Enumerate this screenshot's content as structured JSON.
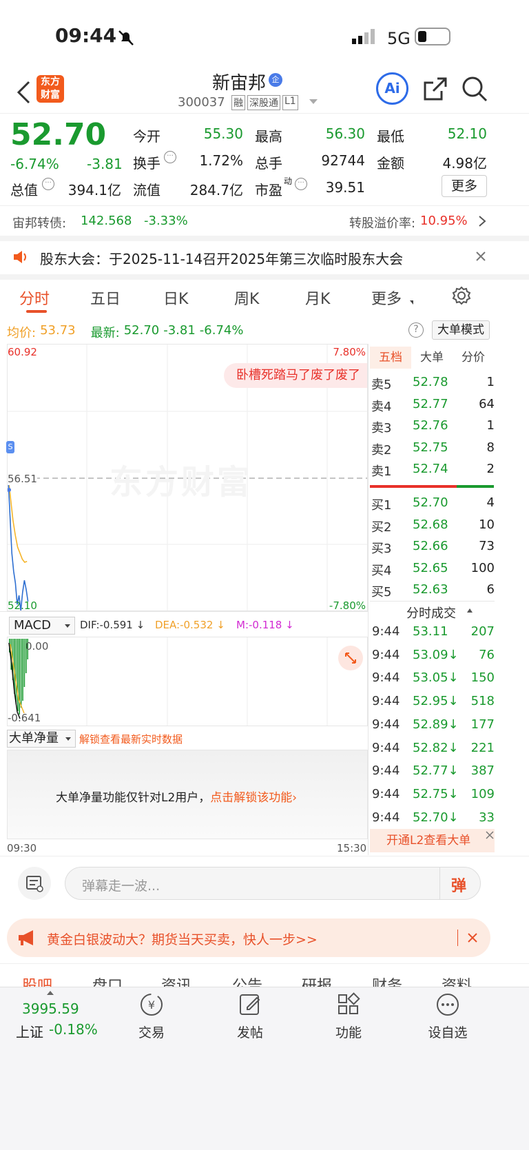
{
  "status": {
    "time": "09:44",
    "network": "5G"
  },
  "header": {
    "stock_name": "新宙邦",
    "badge": "企",
    "code": "300037",
    "tags": [
      "融",
      "深股通",
      "L1"
    ],
    "ai_label": "Ai"
  },
  "logo": {
    "line1": "东方",
    "line2": "财富"
  },
  "quote": {
    "price": "52.70",
    "pct": "-6.74%",
    "chg": "-3.81",
    "r1": [
      [
        "今开",
        "55.30",
        "green"
      ],
      [
        "最高",
        "56.30",
        "green"
      ],
      [
        "最低",
        "52.10",
        "green"
      ]
    ],
    "r2": [
      [
        "换手",
        "1.72%",
        ""
      ],
      [
        "总手",
        "92744",
        ""
      ],
      [
        "金额",
        "4.98亿",
        ""
      ]
    ],
    "r3": [
      [
        "总值",
        "394.1亿"
      ],
      [
        "流值",
        "284.7亿"
      ],
      [
        "市盈",
        "39.51"
      ]
    ],
    "pe_sup": "动",
    "more": "更多"
  },
  "bond": {
    "name": "宙邦转债:",
    "price": "142.568",
    "pct": "-3.33%",
    "premium_label": "转股溢价率:",
    "premium": "10.95%"
  },
  "notice": {
    "text": "股东大会：于2025-11-14召开2025年第三次临时股东大会"
  },
  "tabs": [
    "分时",
    "五日",
    "日K",
    "周K",
    "月K",
    "更多"
  ],
  "info_line": {
    "avg_label": "均价:",
    "avg": "53.73",
    "latest_label": "最新:",
    "latest": "52.70",
    "chg": "-3.81",
    "pct": "-6.74%",
    "mode": "大单模式"
  },
  "chart_axes": {
    "top": "60.92",
    "top_pct": "7.80%",
    "mid": "56.51",
    "bottom": "52.10",
    "bottom_pct": "-7.80%",
    "start_time": "09:30",
    "end_time": "15:30",
    "watermark": "东方财富",
    "danmu": "卧槽死踏马了废了废了"
  },
  "chart_data": {
    "type": "line",
    "series": [
      {
        "name": "价格",
        "values": [
          56.4,
          55.2,
          54.0,
          53.4,
          53.0,
          52.3,
          52.6,
          52.1,
          52.7,
          53.1,
          52.8,
          52.4
        ]
      },
      {
        "name": "均价",
        "values": [
          56.5,
          55.8,
          55.1,
          54.6,
          54.2,
          54.0,
          53.8,
          53.7,
          53.73
        ]
      }
    ],
    "ylim": [
      52.1,
      60.92
    ]
  },
  "macd": {
    "label": "MACD",
    "dif": "DIF:-0.591 ↓",
    "dea": "DEA:-0.532 ↓",
    "m": "M:-0.118 ↓",
    "top": "0.00",
    "bottom": "-0.641"
  },
  "bigorder": {
    "label": "大单净量",
    "unlock": "解锁查看最新实时数据",
    "msg": "大单净量功能仅针对L2用户，",
    "link": "点击解锁该功能›"
  },
  "book": {
    "tabs": [
      "五档",
      "大单",
      "分价"
    ],
    "sells": [
      [
        "卖5",
        "52.78",
        "1"
      ],
      [
        "卖4",
        "52.77",
        "64"
      ],
      [
        "卖3",
        "52.76",
        "1"
      ],
      [
        "卖2",
        "52.75",
        "8"
      ],
      [
        "卖1",
        "52.74",
        "2"
      ]
    ],
    "buys": [
      [
        "买1",
        "52.70",
        "4"
      ],
      [
        "买2",
        "52.68",
        "10"
      ],
      [
        "买3",
        "52.66",
        "73"
      ],
      [
        "买4",
        "52.65",
        "100"
      ],
      [
        "买5",
        "52.63",
        "6"
      ]
    ]
  },
  "ticks": {
    "title": "分时成交",
    "rows": [
      [
        "9:44",
        "53.11",
        "207"
      ],
      [
        "9:44",
        "53.09↓",
        "76"
      ],
      [
        "9:44",
        "53.05↓",
        "150"
      ],
      [
        "9:44",
        "52.95↓",
        "518"
      ],
      [
        "9:44",
        "52.89↓",
        "177"
      ],
      [
        "9:44",
        "52.82↓",
        "221"
      ],
      [
        "9:44",
        "52.77↓",
        "387"
      ],
      [
        "9:44",
        "52.75↓",
        "109"
      ],
      [
        "9:44",
        "52.70↓",
        "33"
      ]
    ],
    "l2": "开通L2查看大单"
  },
  "comment": {
    "placeholder": "弹幕走一波...",
    "btn": "弹"
  },
  "ad": {
    "text": "黄金白银波动大？期货当天买卖，快人一步>>"
  },
  "bottom_tabs": [
    "股吧",
    "盘口",
    "资讯",
    "公告",
    "研报",
    "财务",
    "资料"
  ],
  "nav": {
    "index_value": "3995.59",
    "index_name": "上证",
    "index_pct": "-0.18%",
    "items": [
      "交易",
      "发帖",
      "功能",
      "设自选"
    ]
  }
}
